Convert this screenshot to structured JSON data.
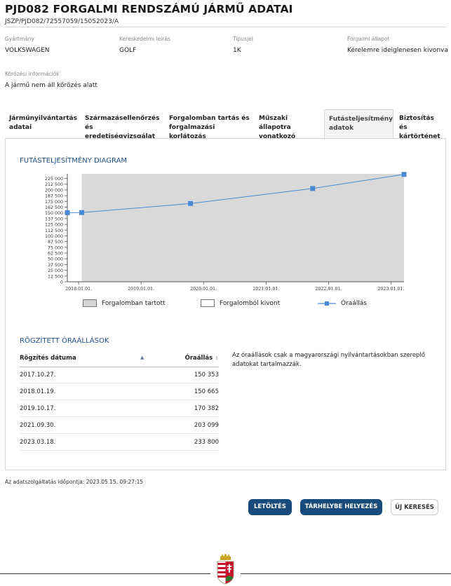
{
  "header": {
    "title": "PJD082 FORGALMI RENDSZÁMÚ JÁRMŰ ADATAI",
    "reference": "JSZP/PJD082/72557059/15052023/A"
  },
  "vehicle": {
    "fields": [
      {
        "label": "Gyártmány",
        "value": "VOLKSWAGEN"
      },
      {
        "label": "Kereskedelmi leírás",
        "value": "GOLF"
      },
      {
        "label": "Típusjel",
        "value": "1K"
      },
      {
        "label": "Forgalmi állapot",
        "value": "Kérelemre ideiglenesen kivonva"
      }
    ],
    "wanted": {
      "label": "Körözési információk",
      "value": "A jármű nem áll körözés alatt"
    }
  },
  "tabs": [
    {
      "line1": "Járműnyilvántartás",
      "line2": "adatai",
      "active": false
    },
    {
      "line1": "Származásellenőrzés",
      "line2": "és eredetiségvizsgálat",
      "active": false
    },
    {
      "line1": "Forgalomban tartás és",
      "line2": "forgalmazási korlátozás",
      "active": false
    },
    {
      "line1": "Műszaki állapotra",
      "line2": "vonatkozó adatok",
      "active": false
    },
    {
      "line1": "Futásteljesítmény",
      "line2": "adatok",
      "active": true
    },
    {
      "line1": "Biztosítás és",
      "line2": "kártörténet",
      "active": false
    }
  ],
  "diagram": {
    "title": "FUTÁSTELJESÍTMÉNY DIAGRAM",
    "legend": {
      "in_traffic": "Forgalomban tartott",
      "withdrawn": "Forgalomból kivont",
      "odometer": "Óraállás"
    }
  },
  "chart_data": {
    "type": "line",
    "x": [
      "2017.10.27.",
      "2018.01.19.",
      "2019.10.17.",
      "2021.09.30.",
      "2023.03.18."
    ],
    "series": [
      {
        "name": "Óraállás",
        "values": [
          150353,
          150665,
          170382,
          203099,
          233800
        ]
      }
    ],
    "ylim": [
      0,
      235000
    ],
    "xlim": [
      "2017.10.27.",
      "2023.03.18."
    ],
    "yticks": [
      0,
      12500,
      25000,
      37500,
      50000,
      62500,
      75000,
      87500,
      100000,
      112500,
      125000,
      137500,
      150000,
      162500,
      175000,
      187500,
      200000,
      212500,
      225000
    ],
    "ytick_labels": [
      "0",
      "12 500",
      "25 000",
      "37 500",
      "50 000",
      "62 500",
      "75 000",
      "87 500",
      "100 000",
      "112 500",
      "125 000",
      "137 500",
      "150 000",
      "162 500",
      "175 000",
      "187 500",
      "200 000",
      "212 500",
      "225 000"
    ],
    "xticks": [
      "2018.01.01.",
      "2019.01.01.",
      "2020.01.01.",
      "2021.01.01.",
      "2022.01.01.",
      "2023.01.01."
    ],
    "bands": [
      {
        "label": "Forgalomban tartott",
        "from": "2018.01.19.",
        "to": "2023.03.18.",
        "color": "#d9d9d9"
      }
    ],
    "line_color": "#4a8ad4",
    "grid": false
  },
  "records": {
    "title": "RÖGZÍTETT ÓRAÁLLÁSOK",
    "col_date": "Rögzítés dátuma",
    "col_value": "Óraállás",
    "rows": [
      {
        "date": "2017.10.27.",
        "value": "150 353"
      },
      {
        "date": "2018.01.19.",
        "value": "150 665"
      },
      {
        "date": "2019.10.17.",
        "value": "170 382"
      },
      {
        "date": "2021.09.30.",
        "value": "203 099"
      },
      {
        "date": "2023.03.18.",
        "value": "233 800"
      }
    ],
    "note": "Az óraállások csak a magyarországi nyilvántartásokban szereplő adatokat tartalmazzák."
  },
  "footer": {
    "timestamp": "Az adatszolgáltatás időpontja: 2023.05.15. 09:27:15",
    "buttons": {
      "download": "LETÖLTÉS",
      "store": "TÁRHELYBE HELYEZÉS",
      "new_search": "ÚJ KERESÉS"
    }
  },
  "colors": {
    "accent": "#184b7b",
    "link": "#1e4f87",
    "band": "#d9d9d9"
  }
}
